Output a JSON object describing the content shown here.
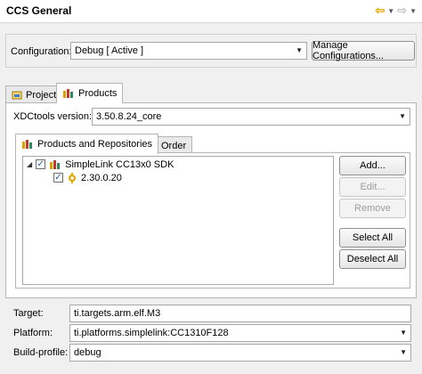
{
  "header": {
    "title": "CCS General",
    "icons": [
      "back-arrow-icon",
      "dropdown-icon",
      "forward-arrow-icon",
      "dropdown-icon"
    ]
  },
  "config": {
    "label": "Configuration:",
    "value": "Debug  [ Active ]",
    "manage_button": "Manage Configurations..."
  },
  "outer_tabs": [
    {
      "label": "Project",
      "icon": "project-icon",
      "selected": false
    },
    {
      "label": "Products",
      "icon": "products-icon",
      "selected": true
    }
  ],
  "xdc": {
    "label": "XDCtools version:",
    "value": "3.50.8.24_core"
  },
  "inner_tabs": [
    {
      "label": "Products and Repositories",
      "icon": "products-icon",
      "selected": true
    },
    {
      "label": "Order",
      "icon": "order-icon",
      "selected": false
    }
  ],
  "tree": {
    "root": {
      "label": "SimpleLink CC13x0 SDK",
      "checked": true,
      "expanded": true,
      "icon": "sdk-icon"
    },
    "child": {
      "label": "2.30.0.20",
      "checked": true,
      "icon": "version-icon"
    }
  },
  "buttons": {
    "add": "Add...",
    "edit": "Edit...",
    "remove": "Remove",
    "select_all": "Select All",
    "deselect_all": "Deselect All"
  },
  "target": {
    "label": "Target:",
    "value": "ti.targets.arm.elf.M3"
  },
  "platform": {
    "label": "Platform:",
    "value": "ti.platforms.simplelink:CC1310F128"
  },
  "build_profile": {
    "label": "Build-profile:",
    "value": "debug"
  }
}
